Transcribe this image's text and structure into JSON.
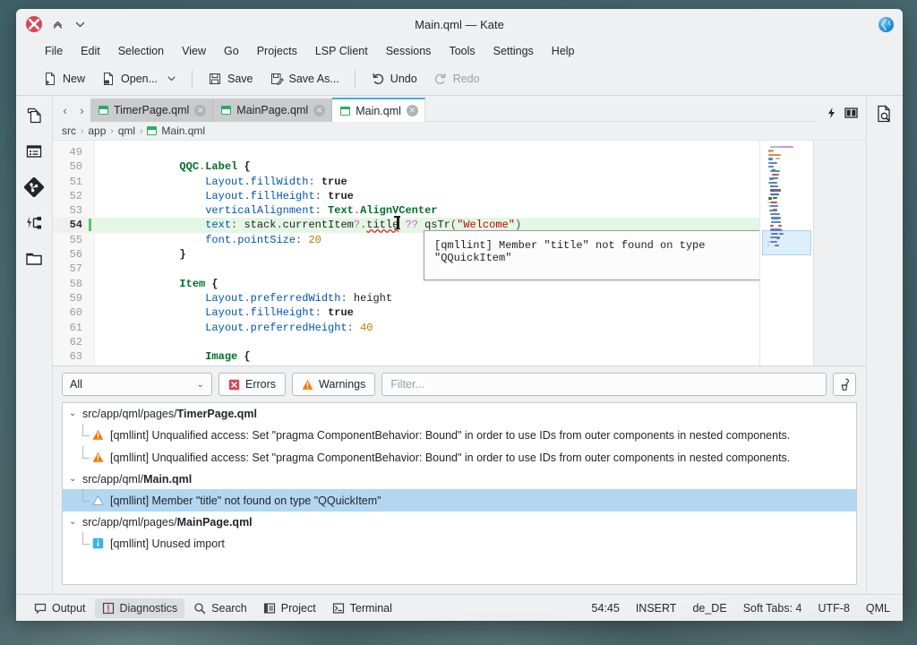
{
  "window": {
    "title": "Main.qml — Kate",
    "close_label": "✕",
    "shade_label": "⌃",
    "unshade_label": "⌄",
    "tray_icon": "globe-icon"
  },
  "menubar": {
    "items": [
      {
        "label": "File"
      },
      {
        "label": "Edit"
      },
      {
        "label": "Selection"
      },
      {
        "label": "View"
      },
      {
        "label": "Go"
      },
      {
        "label": "Projects"
      },
      {
        "label": "LSP Client"
      },
      {
        "label": "Sessions"
      },
      {
        "label": "Tools"
      },
      {
        "label": "Settings"
      },
      {
        "label": "Help"
      }
    ]
  },
  "toolbar": {
    "new_label": "New",
    "open_label": "Open...",
    "save_label": "Save",
    "save_as_label": "Save As...",
    "undo_label": "Undo",
    "redo_label": "Redo"
  },
  "rail": {
    "items": [
      {
        "name": "documents-icon",
        "title": "Documents"
      },
      {
        "name": "outline-icon",
        "title": "Outline"
      },
      {
        "name": "git-icon",
        "title": "Git"
      },
      {
        "name": "lsp-icon",
        "title": "LSP Client"
      },
      {
        "name": "project-icon",
        "title": "Project"
      }
    ]
  },
  "tabs": {
    "prev_label": "‹",
    "next_label": "›",
    "items": [
      {
        "label": "TimerPage.qml",
        "active": false,
        "close": "✕"
      },
      {
        "label": "MainPage.qml",
        "active": false,
        "close": "✕"
      },
      {
        "label": "Main.qml",
        "active": true,
        "close": "✕"
      }
    ],
    "right_icons": [
      {
        "name": "lsp-bolt-icon"
      },
      {
        "name": "split-view-icon"
      }
    ]
  },
  "breadcrumb": {
    "items": [
      "src",
      "app",
      "qml",
      "Main.qml"
    ],
    "separator": "›"
  },
  "right_rail": {
    "items": [
      {
        "name": "search-in-file-icon",
        "title": "Search and Replace"
      }
    ]
  },
  "editor": {
    "first_line": 49,
    "current_line": 54,
    "lines": [
      {
        "n": 49,
        "tokens": []
      },
      {
        "n": 50,
        "tokens": [
          {
            "t": "            ",
            "c": "t-plain"
          },
          {
            "t": "QQC",
            "c": "t-type"
          },
          {
            "t": ".",
            "c": "t-dot"
          },
          {
            "t": "Label",
            "c": "t-type"
          },
          {
            "t": " {",
            "c": "t-kw"
          }
        ]
      },
      {
        "n": 51,
        "tokens": [
          {
            "t": "                ",
            "c": "t-plain"
          },
          {
            "t": "Layout",
            "c": "t-prop"
          },
          {
            "t": ".",
            "c": "t-dot"
          },
          {
            "t": "fillWidth",
            "c": "t-prop"
          },
          {
            "t": ": ",
            "c": "t-dot"
          },
          {
            "t": "true",
            "c": "t-kw"
          }
        ]
      },
      {
        "n": 52,
        "tokens": [
          {
            "t": "                ",
            "c": "t-plain"
          },
          {
            "t": "Layout",
            "c": "t-prop"
          },
          {
            "t": ".",
            "c": "t-dot"
          },
          {
            "t": "fillHeight",
            "c": "t-prop"
          },
          {
            "t": ": ",
            "c": "t-dot"
          },
          {
            "t": "true",
            "c": "t-kw"
          }
        ]
      },
      {
        "n": 53,
        "tokens": [
          {
            "t": "                ",
            "c": "t-plain"
          },
          {
            "t": "verticalAlignment",
            "c": "t-prop"
          },
          {
            "t": ": ",
            "c": "t-dot"
          },
          {
            "t": "Text",
            "c": "t-type"
          },
          {
            "t": ".",
            "c": "t-dot"
          },
          {
            "t": "AlignVCenter",
            "c": "t-type"
          }
        ]
      },
      {
        "n": 54,
        "tokens": [
          {
            "t": "                ",
            "c": "t-plain"
          },
          {
            "t": "text",
            "c": "t-prop"
          },
          {
            "t": ": ",
            "c": "t-dot"
          },
          {
            "t": "stack",
            "c": "t-plain"
          },
          {
            "t": ".",
            "c": "t-dot"
          },
          {
            "t": "currentItem",
            "c": "t-plain"
          },
          {
            "t": "?",
            "c": "t-op"
          },
          {
            "t": ".",
            "c": "t-dot"
          },
          {
            "t": "title",
            "c": "t-plain t-err"
          },
          {
            "t": "CARET",
            "c": "caret"
          },
          {
            "t": " ",
            "c": "t-plain"
          },
          {
            "t": "??",
            "c": "t-op"
          },
          {
            "t": " qsTr",
            "c": "t-fn"
          },
          {
            "t": "(",
            "c": "t-dot"
          },
          {
            "t": "\"Welcome\"",
            "c": "t-str"
          },
          {
            "t": ")",
            "c": "t-dot"
          }
        ]
      },
      {
        "n": 55,
        "tokens": [
          {
            "t": "                ",
            "c": "t-plain"
          },
          {
            "t": "font",
            "c": "t-prop"
          },
          {
            "t": ".",
            "c": "t-dot"
          },
          {
            "t": "pointSize",
            "c": "t-prop"
          },
          {
            "t": ": ",
            "c": "t-dot"
          },
          {
            "t": "20",
            "c": "t-num"
          }
        ]
      },
      {
        "n": 56,
        "tokens": [
          {
            "t": "            }",
            "c": "t-kw"
          }
        ]
      },
      {
        "n": 57,
        "tokens": []
      },
      {
        "n": 58,
        "tokens": [
          {
            "t": "            ",
            "c": "t-plain"
          },
          {
            "t": "Item",
            "c": "t-type"
          },
          {
            "t": " {",
            "c": "t-kw"
          }
        ]
      },
      {
        "n": 59,
        "tokens": [
          {
            "t": "                ",
            "c": "t-plain"
          },
          {
            "t": "Layout",
            "c": "t-prop"
          },
          {
            "t": ".",
            "c": "t-dot"
          },
          {
            "t": "preferredWidth",
            "c": "t-prop"
          },
          {
            "t": ": ",
            "c": "t-dot"
          },
          {
            "t": "height",
            "c": "t-plain"
          }
        ]
      },
      {
        "n": 60,
        "tokens": [
          {
            "t": "                ",
            "c": "t-plain"
          },
          {
            "t": "Layout",
            "c": "t-prop"
          },
          {
            "t": ".",
            "c": "t-dot"
          },
          {
            "t": "fillHeight",
            "c": "t-prop"
          },
          {
            "t": ": ",
            "c": "t-dot"
          },
          {
            "t": "true",
            "c": "t-kw"
          }
        ]
      },
      {
        "n": 61,
        "tokens": [
          {
            "t": "                ",
            "c": "t-plain"
          },
          {
            "t": "Layout",
            "c": "t-prop"
          },
          {
            "t": ".",
            "c": "t-dot"
          },
          {
            "t": "preferredHeight",
            "c": "t-prop"
          },
          {
            "t": ": ",
            "c": "t-dot"
          },
          {
            "t": "40",
            "c": "t-num"
          }
        ]
      },
      {
        "n": 62,
        "tokens": []
      },
      {
        "n": 63,
        "tokens": [
          {
            "t": "                ",
            "c": "t-plain"
          },
          {
            "t": "Image",
            "c": "t-type"
          },
          {
            "t": " {",
            "c": "t-kw"
          }
        ]
      }
    ],
    "tooltip": "[qmllint] Member \"title\" not found on type \"QQuickItem\""
  },
  "diagnostics": {
    "severity_filter": "All",
    "errors_label": "Errors",
    "warnings_label": "Warnings",
    "filter_placeholder": "Filter...",
    "clear_icon": "clear-broom-icon",
    "groups": [
      {
        "path_prefix": "src/app/qml/pages/",
        "path_file": "TimerPage.qml",
        "items": [
          {
            "severity": "warning",
            "text": "[qmllint] Unqualified access: Set \"pragma ComponentBehavior: Bound\" in order to use IDs from outer components in nested components.",
            "selected": false
          },
          {
            "severity": "warning",
            "text": "[qmllint] Unqualified access: Set \"pragma ComponentBehavior: Bound\" in order to use IDs from outer components in nested components.",
            "selected": false
          }
        ]
      },
      {
        "path_prefix": "src/app/qml/",
        "path_file": "Main.qml",
        "items": [
          {
            "severity": "hint",
            "text": "[qmllint] Member \"title\" not found on type \"QQuickItem\"",
            "selected": true
          }
        ]
      },
      {
        "path_prefix": "src/app/qml/pages/",
        "path_file": "MainPage.qml",
        "items": [
          {
            "severity": "info",
            "text": "[qmllint] Unused import",
            "selected": false
          }
        ]
      }
    ]
  },
  "statusbar": {
    "tabs": [
      {
        "label": "Output",
        "icon": "output-icon",
        "active": false
      },
      {
        "label": "Diagnostics",
        "icon": "diagnostics-icon",
        "active": true
      },
      {
        "label": "Search",
        "icon": "search-icon",
        "active": false
      },
      {
        "label": "Project",
        "icon": "project-icon",
        "active": false
      },
      {
        "label": "Terminal",
        "icon": "terminal-icon",
        "active": false
      }
    ],
    "cursor_position": "54:45",
    "input_mode": "INSERT",
    "locale": "de_DE",
    "indentation": "Soft Tabs: 4",
    "encoding": "UTF-8",
    "language": "QML"
  },
  "colors": {
    "accent": "#3daee9",
    "error": "#da4453",
    "warning": "#f67400",
    "info": "#3daee9",
    "current_line": "#e4f7e4",
    "selection": "#b3d7f0"
  }
}
